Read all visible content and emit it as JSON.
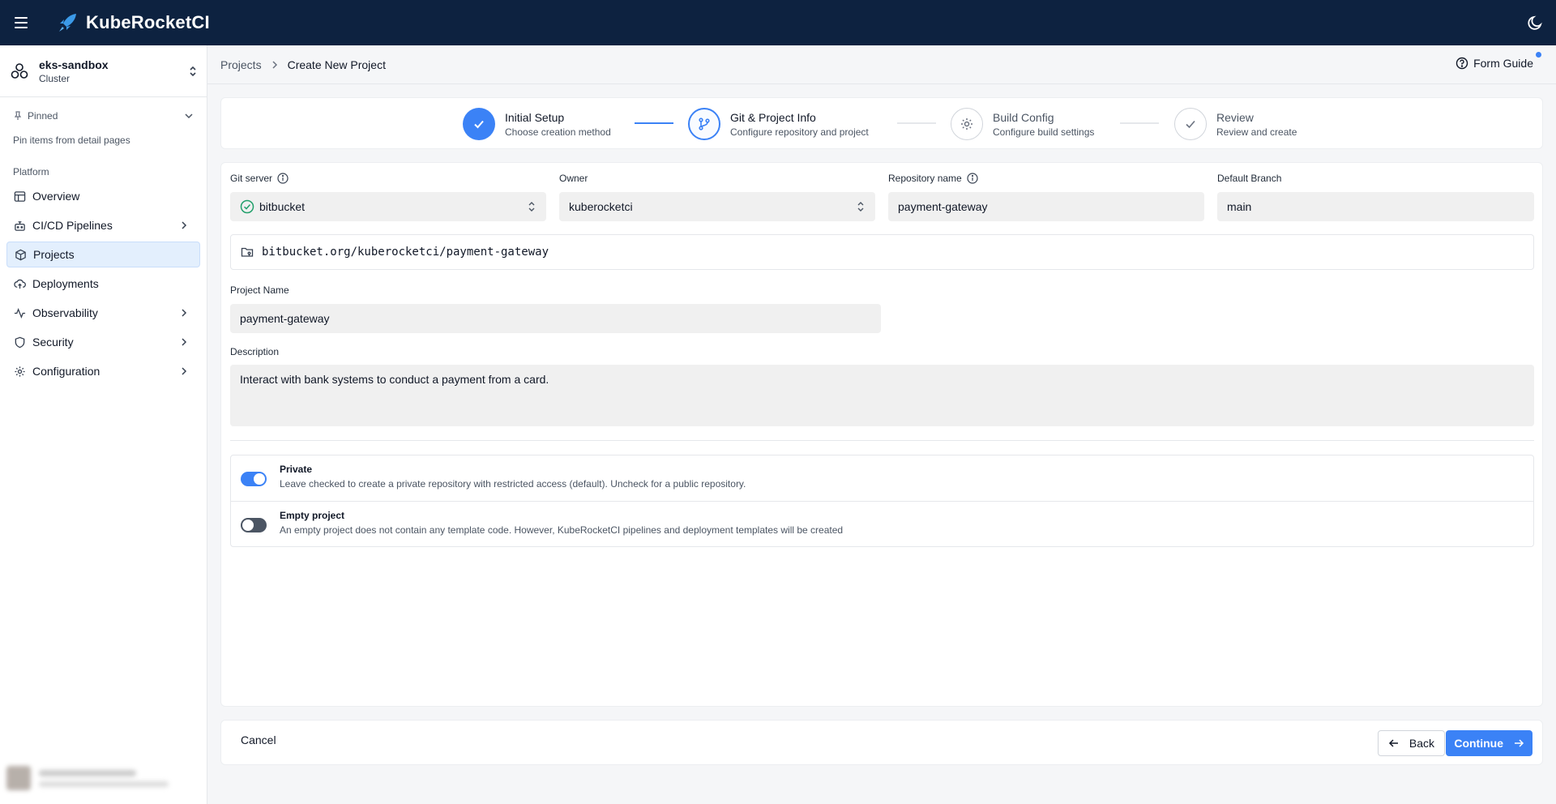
{
  "app": {
    "title": "KubeRocketCI"
  },
  "cluster": {
    "name": "eks-sandbox",
    "type": "Cluster"
  },
  "sidebar": {
    "pinned_label": "Pinned",
    "pinned_hint": "Pin items from detail pages",
    "section_label": "Platform",
    "items": [
      {
        "label": "Overview",
        "icon": "table-icon",
        "expandable": false,
        "active": false
      },
      {
        "label": "CI/CD Pipelines",
        "icon": "bot-icon",
        "expandable": true,
        "active": false
      },
      {
        "label": "Projects",
        "icon": "box-icon",
        "expandable": false,
        "active": true
      },
      {
        "label": "Deployments",
        "icon": "cloud-upload-icon",
        "expandable": false,
        "active": false
      },
      {
        "label": "Observability",
        "icon": "activity-icon",
        "expandable": true,
        "active": false
      },
      {
        "label": "Security",
        "icon": "shield-icon",
        "expandable": true,
        "active": false
      },
      {
        "label": "Configuration",
        "icon": "gear-icon",
        "expandable": true,
        "active": false
      }
    ]
  },
  "breadcrumb": {
    "parent": "Projects",
    "current": "Create New Project"
  },
  "header": {
    "form_guide_label": "Form Guide"
  },
  "stepper": {
    "steps": [
      {
        "title": "Initial Setup",
        "subtitle": "Choose creation method",
        "state": "done"
      },
      {
        "title": "Git & Project Info",
        "subtitle": "Configure repository and project",
        "state": "current"
      },
      {
        "title": "Build Config",
        "subtitle": "Configure build settings",
        "state": "todo"
      },
      {
        "title": "Review",
        "subtitle": "Review and create",
        "state": "todo"
      }
    ]
  },
  "form": {
    "git_server": {
      "label": "Git server",
      "value": "bitbucket"
    },
    "owner": {
      "label": "Owner",
      "value": "kuberocketci"
    },
    "repository_name": {
      "label": "Repository name",
      "value": "payment-gateway"
    },
    "default_branch": {
      "label": "Default Branch",
      "value": "main"
    },
    "repo_url": "bitbucket.org/kuberocketci/payment-gateway",
    "project_name": {
      "label": "Project Name",
      "value": "payment-gateway"
    },
    "description": {
      "label": "Description",
      "value": "Interact with bank systems to conduct a payment from a card."
    },
    "private": {
      "title": "Private",
      "description": "Leave checked to create a private repository with restricted access (default). Uncheck for a public repository.",
      "checked": true
    },
    "empty_project": {
      "title": "Empty project",
      "description": "An empty project does not contain any template code. However, KubeRocketCI pipelines and deployment templates will be created",
      "checked": false
    }
  },
  "footer": {
    "cancel_label": "Cancel",
    "back_label": "Back",
    "continue_label": "Continue"
  },
  "colors": {
    "topbar": "#0d2240",
    "accent": "#3b82f6",
    "success": "#22a06b"
  }
}
